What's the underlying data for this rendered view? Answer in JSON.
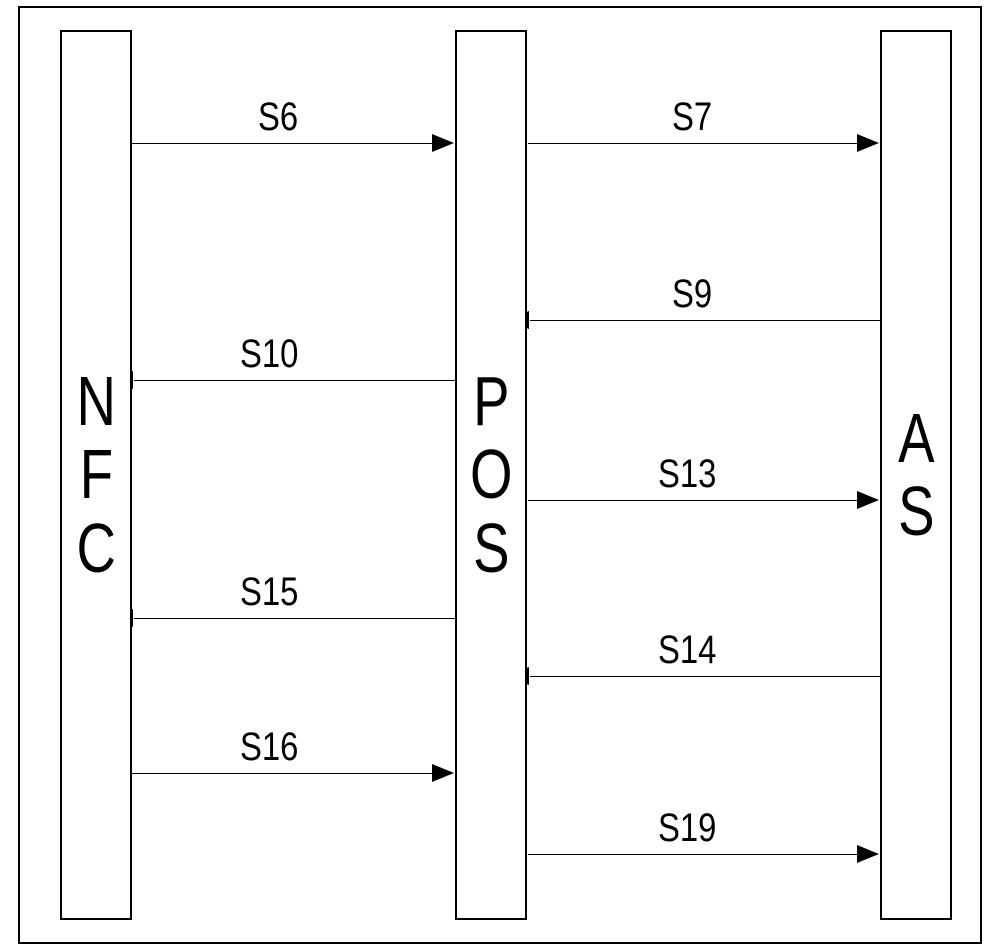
{
  "lifelines": {
    "nfc": {
      "chars": [
        "N",
        "F",
        "C"
      ]
    },
    "pos": {
      "chars": [
        "P",
        "O",
        "S"
      ]
    },
    "as": {
      "chars": [
        "A",
        "S"
      ]
    }
  },
  "messages": {
    "s6": "S6",
    "s7": "S7",
    "s9": "S9",
    "s10": "S10",
    "s13": "S13",
    "s14": "S14",
    "s15": "S15",
    "s16": "S16",
    "s19": "S19"
  }
}
